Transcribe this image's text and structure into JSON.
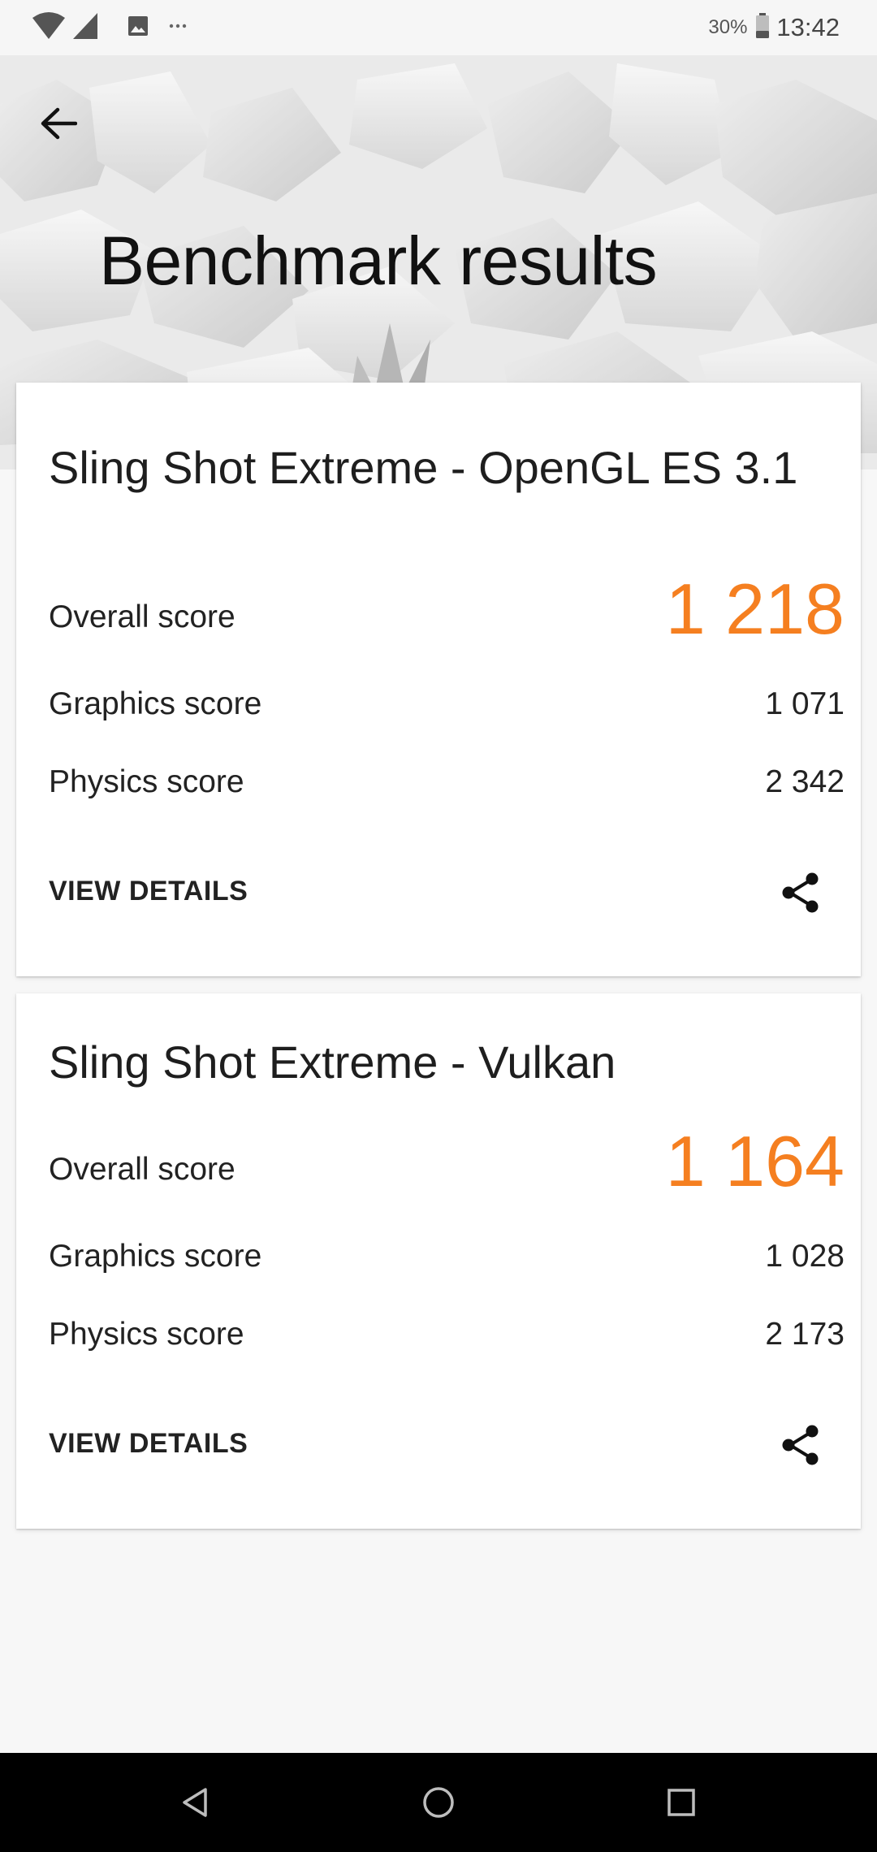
{
  "status_bar": {
    "battery_percent": "30%",
    "time": "13:42",
    "icons": [
      "wifi-icon",
      "signal-icon",
      "image-notification-icon",
      "more-notifications-icon",
      "battery-icon"
    ]
  },
  "header": {
    "title": "Benchmark results",
    "back_icon": "arrow-left-icon"
  },
  "results": [
    {
      "test_name": "Sling Shot Extreme - OpenGL ES 3.1",
      "overall_label": "Overall score",
      "overall_value": "1 218",
      "graphics_label": "Graphics score",
      "graphics_value": "1 071",
      "physics_label": "Physics score",
      "physics_value": "2 342",
      "action_label": "VIEW DETAILS",
      "share_icon": "share-icon"
    },
    {
      "test_name": "Sling Shot Extreme - Vulkan",
      "overall_label": "Overall score",
      "overall_value": "1 164",
      "graphics_label": "Graphics score",
      "graphics_value": "1 028",
      "physics_label": "Physics score",
      "physics_value": "2 173",
      "action_label": "VIEW DETAILS",
      "share_icon": "share-icon"
    }
  ],
  "colors": {
    "accent": "#f57f20",
    "background": "#f7f7f7",
    "card": "#ffffff",
    "nav_bar": "#000000"
  },
  "nav_bar": {
    "icons": [
      "back-triangle-icon",
      "home-circle-icon",
      "recents-square-icon"
    ]
  }
}
